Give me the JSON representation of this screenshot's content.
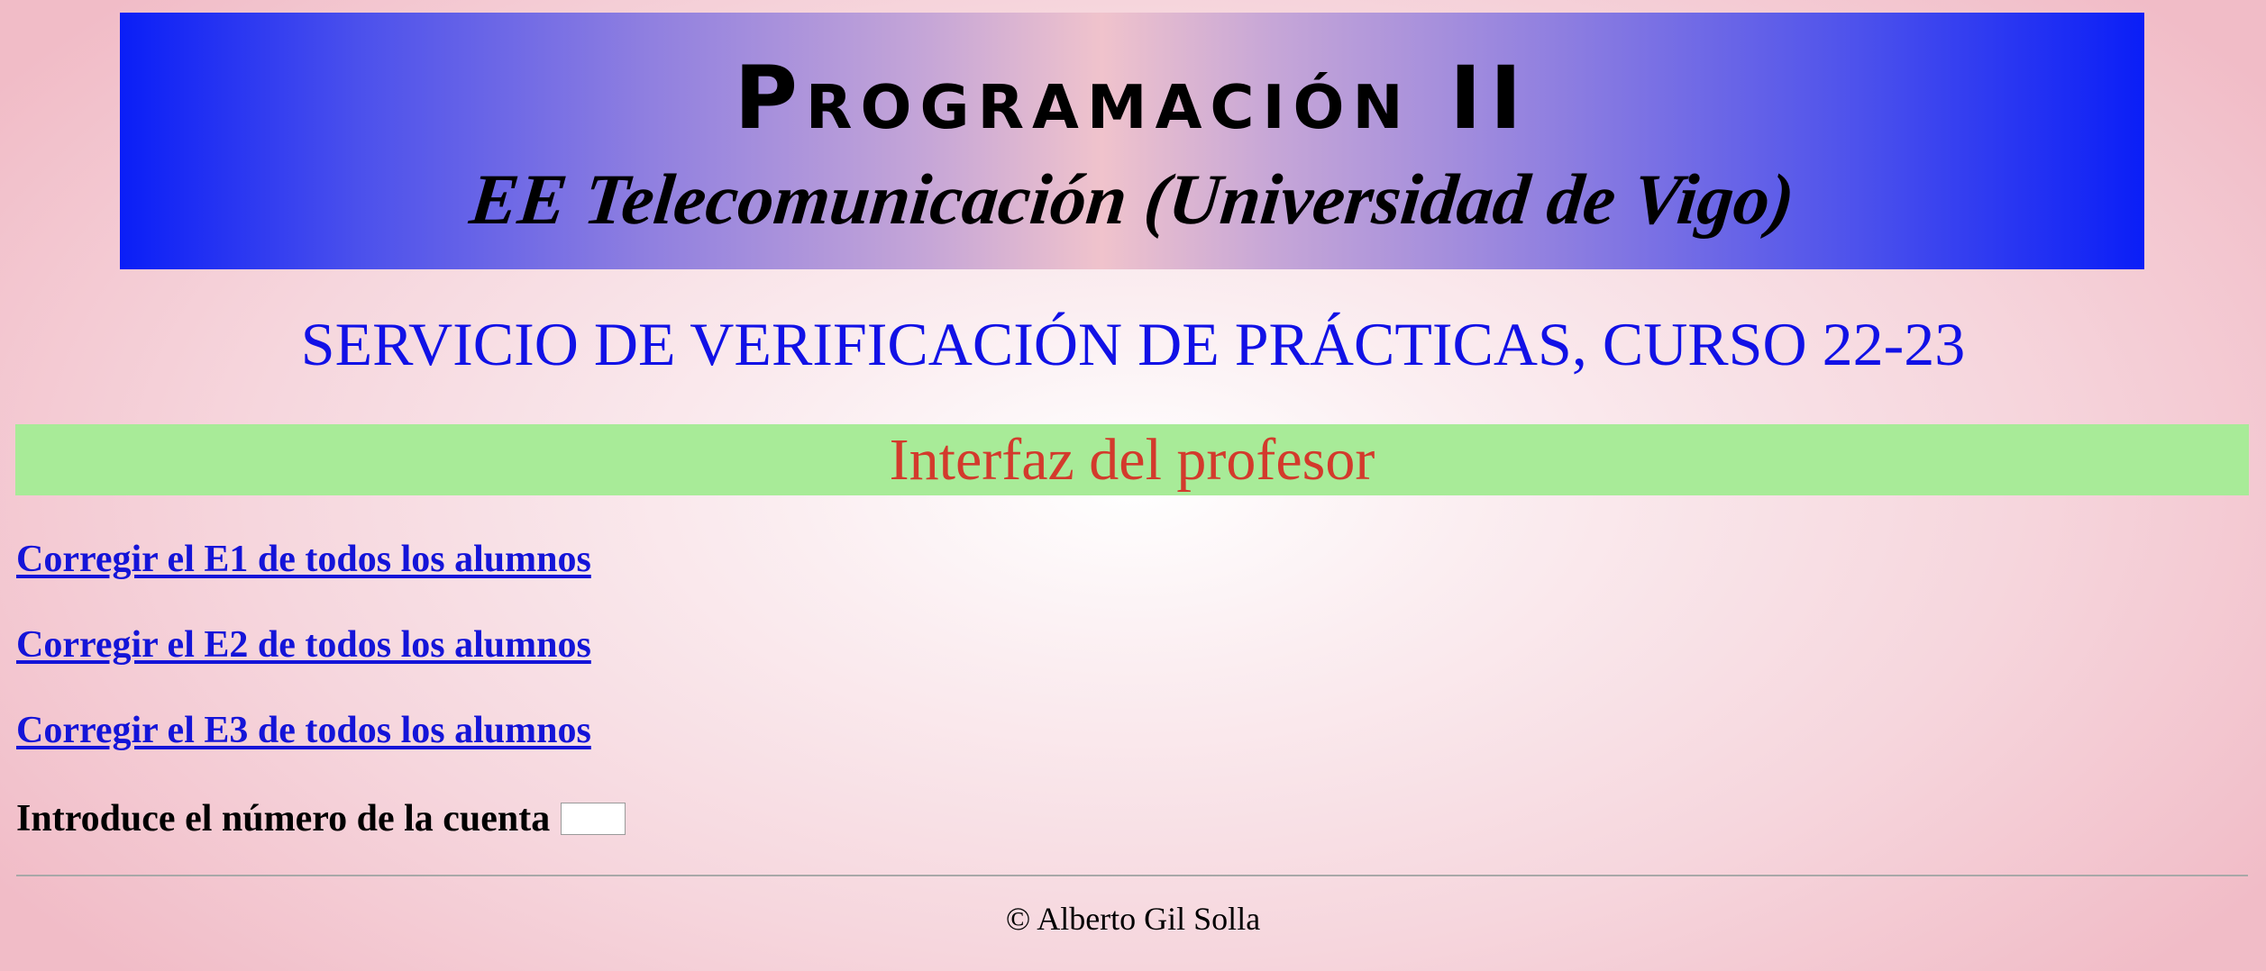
{
  "header": {
    "title": "Programación II",
    "subtitle": "EE Telecomunicación (Universidad de Vigo)",
    "gradient_edge_color": "#0a1ef7",
    "gradient_center_color": "#f0c3cc"
  },
  "service_title": "SERVICIO DE VERIFICACIÓN DE PRÁCTICAS, CURSO 22-23",
  "interface_label": "Interfaz del profesor",
  "links": [
    {
      "label": "Corregir el E1 de todos los alumnos"
    },
    {
      "label": "Corregir el E2 de todos los alumnos"
    },
    {
      "label": "Corregir el E3 de todos los alumnos"
    }
  ],
  "account": {
    "label": "Introduce el número de la cuenta",
    "value": ""
  },
  "footer": {
    "copyright": "© Alberto Gil Solla"
  },
  "colors": {
    "service_title": "#1111e6",
    "interface_bar": "#a8eb98",
    "interface_text": "#d33a2c",
    "link": "#1414d8"
  }
}
